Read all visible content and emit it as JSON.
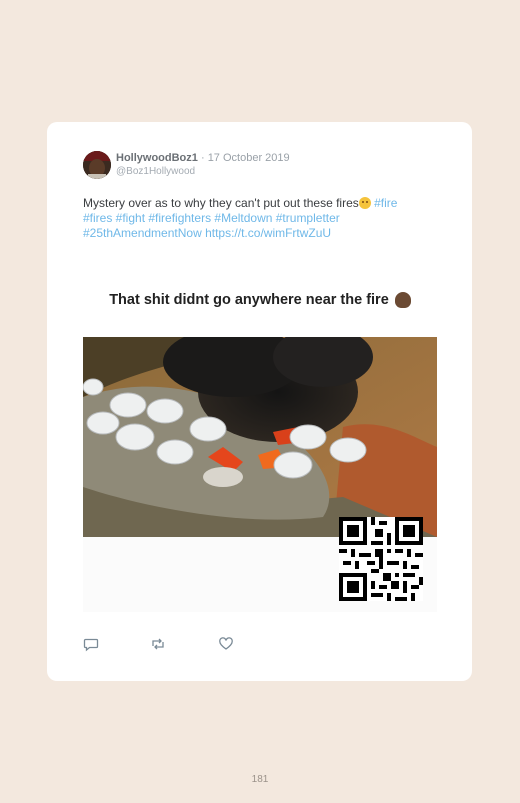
{
  "tweet": {
    "display_name": "HollywoodBoz1",
    "separator": "·",
    "date": "17 October 2019",
    "handle": "@Boz1Hollywood",
    "text_plain": "Mystery over as to why they can't put out these fires",
    "hashtag_1": "#fire",
    "hashtags_line2": "#fires #fight #firefighters #Meltdown #trumpletter",
    "hashtag_line3": "#25thAmendmentNow",
    "url": "https://t.co/wimFrtwZuU"
  },
  "media": {
    "caption": "That shit didnt go anywhere near the fire"
  },
  "icons": {
    "reply": "reply-icon",
    "retweet": "retweet-icon",
    "like": "heart-icon",
    "emoji": "flushed-face-emoji",
    "caption_emoji": "person-emoji"
  },
  "colors": {
    "background": "#f3e8de",
    "link": "#6fb8e8",
    "card": "#ffffff"
  },
  "page_number": "181"
}
